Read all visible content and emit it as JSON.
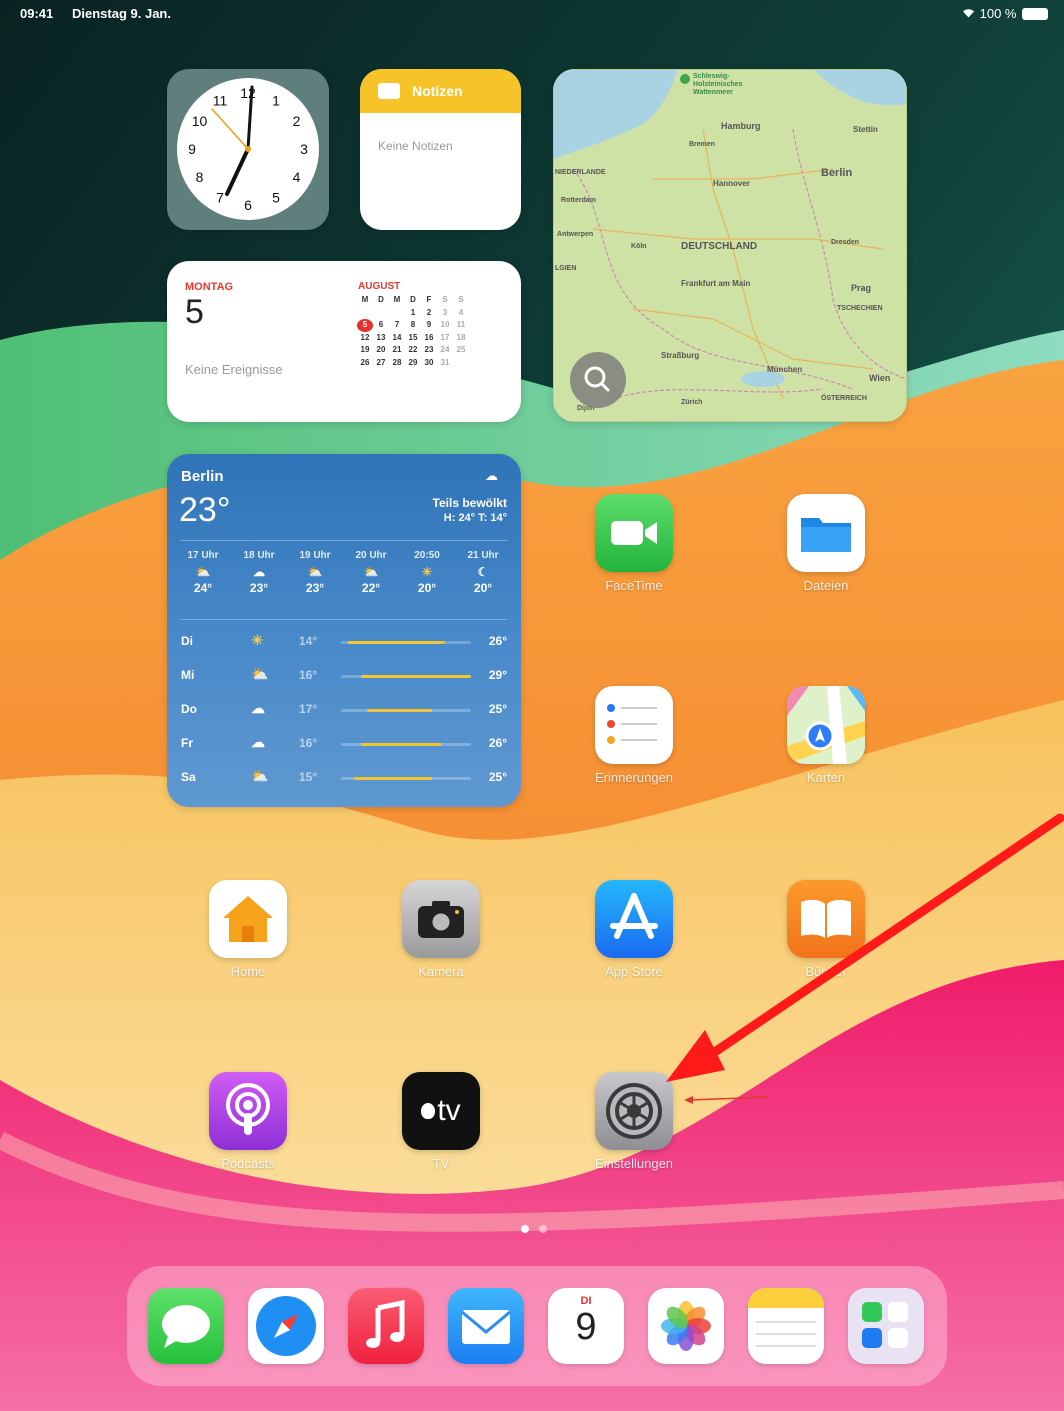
{
  "status_bar": {
    "time": "09:41",
    "date": "Dienstag 9. Jan.",
    "battery": "100 %"
  },
  "clock_widget": {
    "numbers": [
      "12",
      "1",
      "2",
      "3",
      "4",
      "5",
      "6",
      "7",
      "8",
      "9",
      "10",
      "11"
    ]
  },
  "notes_widget": {
    "title": "Notizen",
    "empty": "Keine Notizen"
  },
  "calendar_widget": {
    "weekday": "MONTAG",
    "day": "5",
    "empty": "Keine Ereignisse",
    "month": "AUGUST",
    "headers": [
      "M",
      "D",
      "M",
      "D",
      "F",
      "S",
      "S"
    ],
    "weeks": [
      [
        "",
        "",
        "",
        "1",
        "2",
        "3",
        "4"
      ],
      [
        "5",
        "6",
        "7",
        "8",
        "9",
        "10",
        "11"
      ],
      [
        "12",
        "13",
        "14",
        "15",
        "16",
        "17",
        "18"
      ],
      [
        "19",
        "20",
        "21",
        "22",
        "23",
        "24",
        "25"
      ],
      [
        "26",
        "27",
        "28",
        "29",
        "30",
        "31",
        ""
      ]
    ],
    "today": "5"
  },
  "map_widget": {
    "labels": {
      "schleswig": "Schleswig-Holsteinisches Wattenmeer",
      "hamburg": "Hamburg",
      "stettin": "Stettin",
      "bremen": "Bremen",
      "niederlande": "NIEDERLANDE",
      "hannover": "Hannover",
      "berlin": "Berlin",
      "rotterdam": "Rotterdam",
      "antwerpen": "Antwerpen",
      "koln": "Köln",
      "deutschland": "DEUTSCHLAND",
      "dresden": "Dresden",
      "lgien": "LGIEN",
      "frankfurt": "Frankfurt am Main",
      "prag": "Prag",
      "tschechien": "TSCHECHIEN",
      "strassburg": "Straßburg",
      "munchen": "München",
      "wien": "Wien",
      "dijon": "Dijon",
      "zurich": "Zürich",
      "osterreich": "ÖSTERREICH"
    }
  },
  "weather_widget": {
    "city": "Berlin",
    "temp": "23°",
    "condition": "Teils bewölkt",
    "hilo": "H: 24° T: 14°",
    "hourly": [
      {
        "time": "17 Uhr",
        "temp": "24°",
        "icon": "cloud-sun-icon"
      },
      {
        "time": "18 Uhr",
        "temp": "23°",
        "icon": "cloud-icon"
      },
      {
        "time": "19 Uhr",
        "temp": "23°",
        "icon": "cloud-sun-icon"
      },
      {
        "time": "20 Uhr",
        "temp": "22°",
        "icon": "cloud-sun-icon"
      },
      {
        "time": "20:50",
        "temp": "20°",
        "icon": "sunset-icon"
      },
      {
        "time": "21 Uhr",
        "temp": "20°",
        "icon": "moon-icon"
      }
    ],
    "daily": [
      {
        "day": "Di",
        "low": "14°",
        "high": "26°",
        "icon": "sun-icon",
        "start": 0.05,
        "end": 0.8
      },
      {
        "day": "Mi",
        "low": "16°",
        "high": "29°",
        "icon": "cloud-sun-icon",
        "start": 0.15,
        "end": 1.0
      },
      {
        "day": "Do",
        "low": "17°",
        "high": "25°",
        "icon": "cloud-icon",
        "start": 0.2,
        "end": 0.7
      },
      {
        "day": "Fr",
        "low": "16°",
        "high": "26°",
        "icon": "cloud-icon",
        "start": 0.15,
        "end": 0.78
      },
      {
        "day": "Sa",
        "low": "15°",
        "high": "25°",
        "icon": "cloud-sun-icon",
        "start": 0.1,
        "end": 0.7
      }
    ]
  },
  "apps": {
    "facetime": "FaceTime",
    "dateien": "Dateien",
    "erinnerungen": "Erinnerungen",
    "karten": "Karten",
    "home": "Home",
    "kamera": "Kamera",
    "appstore": "App Store",
    "bucher": "Bücher",
    "podcasts": "Podcasts",
    "tv": "TV",
    "einstellungen": "Einstellungen"
  },
  "tv_icon_text": "tv",
  "dock": {
    "calendar_weekday": "DI",
    "calendar_day": "9",
    "icons": [
      "messages-icon",
      "safari-icon",
      "music-icon",
      "mail-icon",
      "calendar-icon",
      "photos-icon",
      "notes-icon",
      "app-library-icon"
    ]
  },
  "colors": {
    "annotation_arrow": "#ff1a1a"
  }
}
